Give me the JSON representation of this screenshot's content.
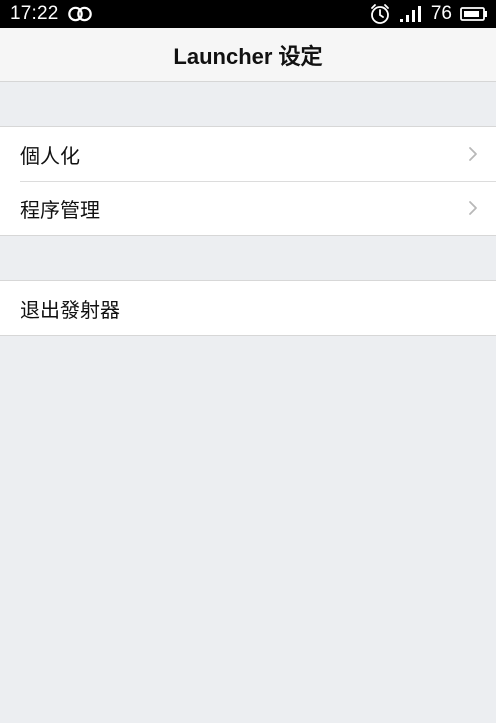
{
  "status_bar": {
    "time": "17:22",
    "battery_percent": "76",
    "icons": [
      "link-rings-icon",
      "alarm-clock-icon",
      "signal-icon",
      "battery-icon"
    ]
  },
  "header": {
    "title": "Launcher 设定"
  },
  "groups": [
    {
      "items": [
        {
          "label": "個人化",
          "has_chevron": true
        },
        {
          "label": "程序管理",
          "has_chevron": true
        }
      ]
    },
    {
      "items": [
        {
          "label": "退出發射器",
          "has_chevron": false
        }
      ]
    }
  ],
  "colors": {
    "background": "#eceef1",
    "header_background": "#f6f6f6",
    "status_bar": "#000000",
    "chevron": "#b8b8b8"
  }
}
